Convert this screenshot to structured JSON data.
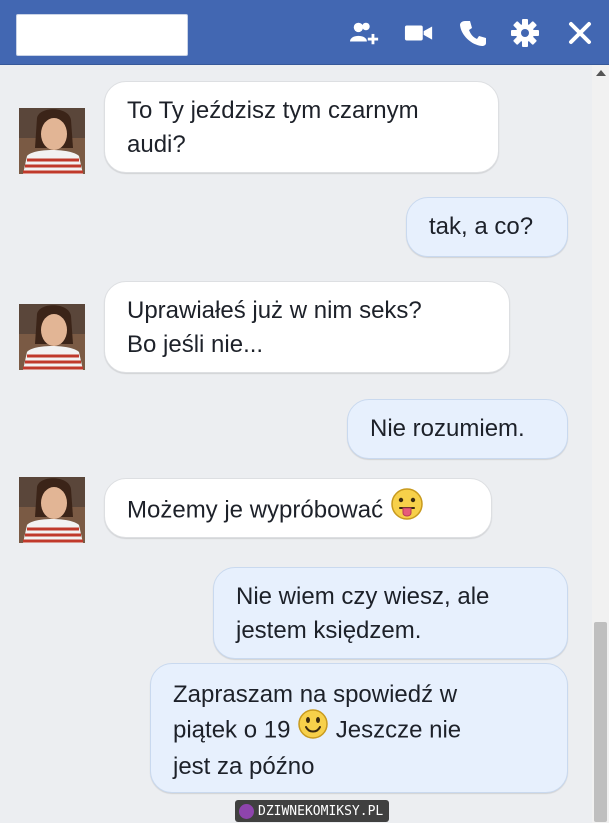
{
  "header": {
    "contact_name": "",
    "icons": [
      "add-friend-icon",
      "video-call-icon",
      "phone-call-icon",
      "settings-gear-icon",
      "close-icon"
    ],
    "color": "#4267b2"
  },
  "messages": [
    {
      "from": "them",
      "lines": [
        "To Ty jeździsz tym czarnym",
        "audi?"
      ]
    },
    {
      "from": "me",
      "lines": [
        "tak, a co?"
      ]
    },
    {
      "from": "them",
      "lines": [
        "Uprawiałeś już w nim seks?",
        "Bo jeśli nie..."
      ]
    },
    {
      "from": "me",
      "lines": [
        "Nie rozumiem."
      ]
    },
    {
      "from": "them",
      "text": "Możemy je wypróbować",
      "emoji": "tongue-out-face-icon"
    },
    {
      "from": "me",
      "lines": [
        "Nie wiem czy wiesz, ale",
        "jestem księdzem."
      ]
    },
    {
      "from": "me",
      "line1": "Zapraszam na spowiedź w",
      "line2_a": "piątek o 19",
      "emoji": "smiley-face-icon",
      "line2_b": "Jeszcze nie",
      "line3": "jest za późno"
    }
  ],
  "watermark": "DZIWNEKOMIKSY.PL",
  "colors": {
    "incoming_bubble": "#ffffff",
    "outgoing_bubble": "#e7f0fd",
    "chat_background": "#eceef1"
  }
}
